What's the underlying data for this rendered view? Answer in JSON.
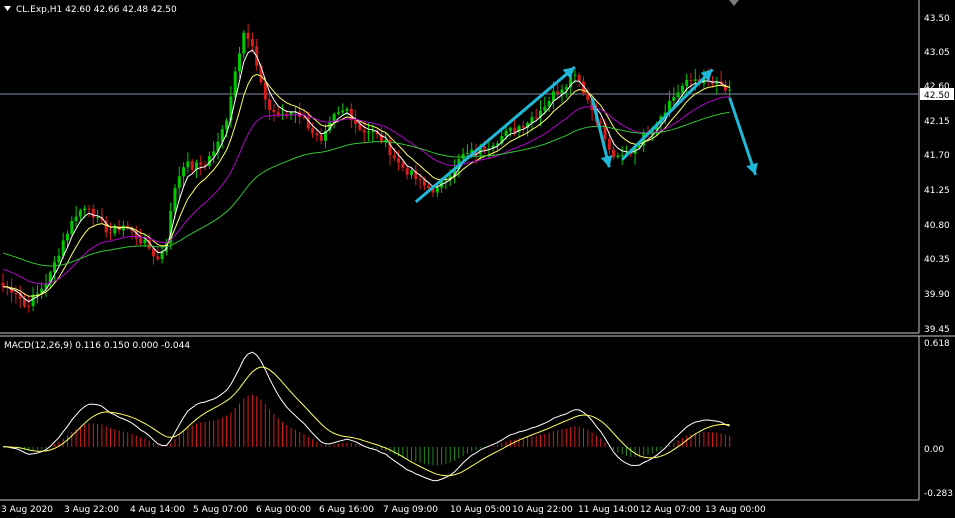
{
  "colors": {
    "background": "#000000",
    "bull_candle": "#00c800",
    "bear_candle": "#d81c1c",
    "axis": "#c8c8c8",
    "text": "#ffffff",
    "bid_line": "#7f8fa6",
    "arrow": "#1fb8d6",
    "ma_fast": "#ffffff",
    "ma_mid": "#ffff66",
    "ma_slow": "#b000c8",
    "ma_long": "#36c236",
    "macd_hist_pos": "#d81c1c",
    "macd_hist_neg": "#1c8a1c",
    "macd_main": "#ffffff",
    "macd_signal": "#ffff66"
  },
  "header": {
    "dropdown_icon": "triangle-down-icon",
    "symbol_info": "CL.Exp,H1  42.60 42.66 42.48 42.50"
  },
  "price_axis": {
    "labels": [
      "43.50",
      "43.05",
      "42.60",
      "42.15",
      "41.70",
      "41.25",
      "40.80",
      "40.35",
      "39.90",
      "39.45"
    ],
    "current_price": "42.50"
  },
  "macd": {
    "title": "MACD(12,26,9) 0.116 0.150 0.000 -0.044",
    "axis_labels": [
      "0.618",
      "0.00",
      "-0.283"
    ]
  },
  "time_axis": {
    "labels": [
      "3 Aug 2020",
      "3 Aug 22:00",
      "4 Aug 14:00",
      "5 Aug 07:00",
      "6 Aug 00:00",
      "6 Aug 16:00",
      "7 Aug 09:00",
      "10 Aug 05:00",
      "10 Aug 22:00",
      "11 Aug 14:00",
      "12 Aug 07:00",
      "13 Aug 00:00"
    ]
  },
  "chart_data": {
    "type": "candlestick",
    "ylim": [
      39.45,
      43.5
    ],
    "current_price": 42.5,
    "price_anchors": [
      [
        0,
        40.0
      ],
      [
        3,
        39.95
      ],
      [
        5,
        39.75
      ],
      [
        8,
        39.9
      ],
      [
        11,
        40.15
      ],
      [
        14,
        40.6
      ],
      [
        17,
        40.95
      ],
      [
        20,
        41.05
      ],
      [
        22,
        40.85
      ],
      [
        25,
        40.7
      ],
      [
        28,
        40.8
      ],
      [
        31,
        40.65
      ],
      [
        34,
        40.5
      ],
      [
        36,
        40.35
      ],
      [
        38,
        40.6
      ],
      [
        40,
        41.3
      ],
      [
        42,
        41.6
      ],
      [
        44,
        41.55
      ],
      [
        47,
        41.6
      ],
      [
        50,
        41.85
      ],
      [
        52,
        42.2
      ],
      [
        54,
        42.8
      ],
      [
        56,
        43.35
      ],
      [
        58,
        43.1
      ],
      [
        60,
        42.6
      ],
      [
        62,
        42.3
      ],
      [
        65,
        42.2
      ],
      [
        68,
        42.3
      ],
      [
        71,
        42.1
      ],
      [
        74,
        41.85
      ],
      [
        77,
        42.2
      ],
      [
        80,
        42.3
      ],
      [
        83,
        42.05
      ],
      [
        86,
        42.0
      ],
      [
        89,
        41.85
      ],
      [
        92,
        41.6
      ],
      [
        95,
        41.45
      ],
      [
        98,
        41.3
      ],
      [
        101,
        41.25
      ],
      [
        104,
        41.5
      ],
      [
        107,
        41.7
      ],
      [
        110,
        41.75
      ],
      [
        113,
        41.85
      ],
      [
        116,
        41.95
      ],
      [
        119,
        42.05
      ],
      [
        122,
        42.15
      ],
      [
        125,
        42.3
      ],
      [
        128,
        42.5
      ],
      [
        131,
        42.65
      ],
      [
        133,
        42.8
      ],
      [
        135,
        42.55
      ],
      [
        137,
        42.3
      ],
      [
        139,
        42.1
      ],
      [
        141,
        41.75
      ],
      [
        143,
        41.65
      ],
      [
        146,
        41.75
      ],
      [
        149,
        41.95
      ],
      [
        152,
        42.15
      ],
      [
        155,
        42.4
      ],
      [
        158,
        42.6
      ],
      [
        161,
        42.7
      ],
      [
        164,
        42.65
      ],
      [
        167,
        42.6
      ],
      [
        169,
        42.5
      ]
    ],
    "moving_averages": [
      "ma_fast",
      "ma_mid",
      "ma_slow",
      "ma_long"
    ],
    "annotations": [
      {
        "type": "arrow",
        "from": [
          96,
          41.1
        ],
        "to": [
          133,
          42.85
        ]
      },
      {
        "type": "arrow",
        "from": [
          137,
          42.45
        ],
        "to": [
          141,
          41.55
        ]
      },
      {
        "type": "arrow",
        "from": [
          144,
          41.65
        ],
        "to": [
          165,
          42.82
        ]
      },
      {
        "type": "arrow",
        "from": [
          169,
          42.45
        ],
        "to": [
          175,
          41.45
        ]
      }
    ],
    "macd": {
      "params": "12,26,9",
      "values": [
        0.116,
        0.15,
        0.0,
        -0.044
      ],
      "ylim": [
        -0.283,
        0.618
      ]
    }
  }
}
